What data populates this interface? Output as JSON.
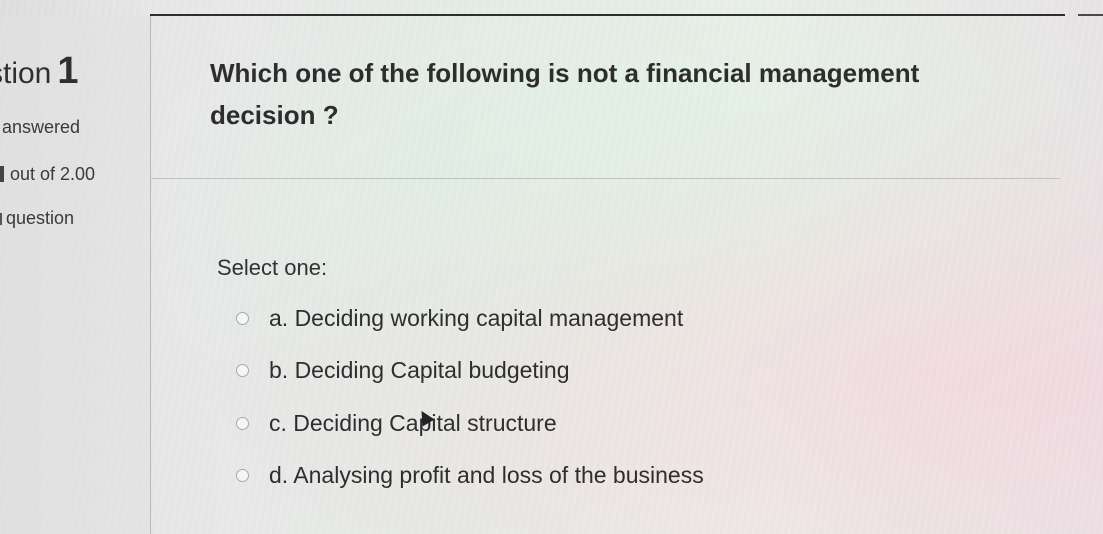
{
  "sidebar": {
    "question_word": "stion",
    "question_number": "1",
    "status": "answered",
    "mark": "out of 2.00",
    "flag_label": "question"
  },
  "question": {
    "text": "Which one of the following is not a financial management decision ?"
  },
  "answer": {
    "select_label": "Select one:",
    "options": [
      {
        "label": "a. Deciding working capital management"
      },
      {
        "label": "b. Deciding Capital budgeting"
      },
      {
        "label": "c. Deciding Capital structure"
      },
      {
        "label": "d. Analysing profit and loss of the business"
      }
    ]
  },
  "icons": {
    "radio": "radio-button-icon",
    "cursor": "mouse-pointer-icon",
    "flag": "flag-icon"
  }
}
